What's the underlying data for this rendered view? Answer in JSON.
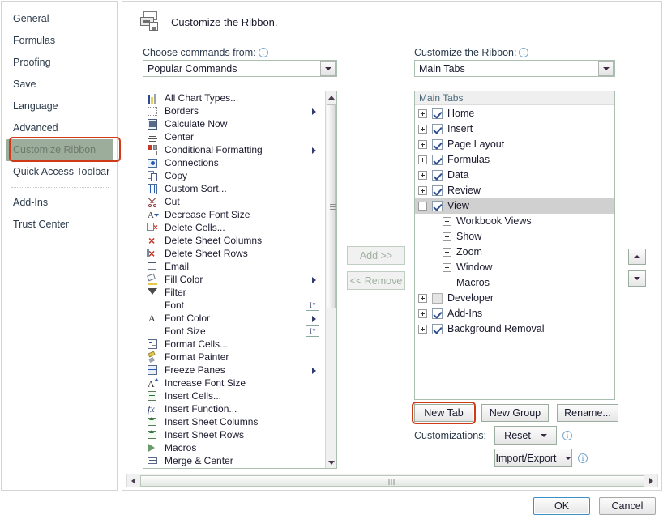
{
  "sidebar": {
    "items": [
      {
        "label": "General",
        "selected": false
      },
      {
        "label": "Formulas",
        "selected": false
      },
      {
        "label": "Proofing",
        "selected": false
      },
      {
        "label": "Save",
        "selected": false
      },
      {
        "label": "Language",
        "selected": false
      },
      {
        "label": "Advanced",
        "selected": false
      },
      {
        "label": "Customize Ribbon",
        "selected": true
      },
      {
        "label": "Quick Access Toolbar",
        "selected": false
      },
      {
        "label": "Add-Ins",
        "selected": false
      },
      {
        "label": "Trust Center",
        "selected": false
      }
    ]
  },
  "header": {
    "title": "Customize the Ribbon.",
    "icon": "customize-ribbon-icon"
  },
  "left_panel": {
    "label_prefix": "C",
    "label_rest": "hoose commands from:",
    "info_icon": "info-icon",
    "dropdown_value": "Popular Commands",
    "commands": [
      {
        "label": "All Chart Types...",
        "icon": "chart-icon",
        "submenu": false,
        "combo": false
      },
      {
        "label": "Borders",
        "icon": "borders-icon",
        "submenu": true,
        "combo": false
      },
      {
        "label": "Calculate Now",
        "icon": "calculator-icon",
        "submenu": false,
        "combo": false
      },
      {
        "label": "Center",
        "icon": "center-align-icon",
        "submenu": false,
        "combo": false
      },
      {
        "label": "Conditional Formatting",
        "icon": "conditional-formatting-icon",
        "submenu": true,
        "combo": false
      },
      {
        "label": "Connections",
        "icon": "connections-icon",
        "submenu": false,
        "combo": false
      },
      {
        "label": "Copy",
        "icon": "copy-icon",
        "submenu": false,
        "combo": false
      },
      {
        "label": "Custom Sort...",
        "icon": "sort-icon",
        "submenu": false,
        "combo": false
      },
      {
        "label": "Cut",
        "icon": "scissors-icon",
        "submenu": false,
        "combo": false
      },
      {
        "label": "Decrease Font Size",
        "icon": "decrease-font-icon",
        "submenu": false,
        "combo": false
      },
      {
        "label": "Delete Cells...",
        "icon": "delete-cells-icon",
        "submenu": false,
        "combo": false
      },
      {
        "label": "Delete Sheet Columns",
        "icon": "delete-columns-icon",
        "submenu": false,
        "combo": false
      },
      {
        "label": "Delete Sheet Rows",
        "icon": "delete-rows-icon",
        "submenu": false,
        "combo": false
      },
      {
        "label": "Email",
        "icon": "email-icon",
        "submenu": false,
        "combo": false
      },
      {
        "label": "Fill Color",
        "icon": "fill-color-icon",
        "submenu": true,
        "combo": false
      },
      {
        "label": "Filter",
        "icon": "filter-icon",
        "submenu": false,
        "combo": false
      },
      {
        "label": "Font",
        "icon": "none",
        "submenu": false,
        "combo": true
      },
      {
        "label": "Font Color",
        "icon": "font-color-icon",
        "submenu": true,
        "combo": false
      },
      {
        "label": "Font Size",
        "icon": "none",
        "submenu": false,
        "combo": true
      },
      {
        "label": "Format Cells...",
        "icon": "format-cells-icon",
        "submenu": false,
        "combo": false
      },
      {
        "label": "Format Painter",
        "icon": "format-painter-icon",
        "submenu": false,
        "combo": false
      },
      {
        "label": "Freeze Panes",
        "icon": "freeze-panes-icon",
        "submenu": true,
        "combo": false
      },
      {
        "label": "Increase Font Size",
        "icon": "increase-font-icon",
        "submenu": false,
        "combo": false
      },
      {
        "label": "Insert Cells...",
        "icon": "insert-cells-icon",
        "submenu": false,
        "combo": false
      },
      {
        "label": "Insert Function...",
        "icon": "insert-function-icon",
        "submenu": false,
        "combo": false
      },
      {
        "label": "Insert Sheet Columns",
        "icon": "insert-columns-icon",
        "submenu": false,
        "combo": false
      },
      {
        "label": "Insert Sheet Rows",
        "icon": "insert-rows-icon",
        "submenu": false,
        "combo": false
      },
      {
        "label": "Macros",
        "icon": "macros-icon",
        "submenu": false,
        "combo": false
      },
      {
        "label": "Merge & Center",
        "icon": "merge-center-icon",
        "submenu": false,
        "combo": false
      }
    ]
  },
  "transfer": {
    "add_prefix": "",
    "add_label": "Add >>",
    "remove_label": "<< Remove",
    "add_enabled": false,
    "remove_enabled": false
  },
  "right_panel": {
    "label_prefix": "Customize the Ri",
    "label_rest": "bbon:",
    "info_icon": "info-icon",
    "dropdown_value": "Main Tabs",
    "tree_header": "Main Tabs",
    "tree": [
      {
        "label": "Home",
        "level": 0,
        "checkbox": "checked",
        "expander": "plus",
        "selected": false
      },
      {
        "label": "Insert",
        "level": 0,
        "checkbox": "checked",
        "expander": "plus",
        "selected": false
      },
      {
        "label": "Page Layout",
        "level": 0,
        "checkbox": "checked",
        "expander": "plus",
        "selected": false
      },
      {
        "label": "Formulas",
        "level": 0,
        "checkbox": "checked",
        "expander": "plus",
        "selected": false
      },
      {
        "label": "Data",
        "level": 0,
        "checkbox": "checked",
        "expander": "plus",
        "selected": false
      },
      {
        "label": "Review",
        "level": 0,
        "checkbox": "checked",
        "expander": "plus",
        "selected": false
      },
      {
        "label": "View",
        "level": 0,
        "checkbox": "checked",
        "expander": "minus",
        "selected": true
      },
      {
        "label": "Workbook Views",
        "level": 1,
        "checkbox": "none",
        "expander": "plus",
        "selected": false
      },
      {
        "label": "Show",
        "level": 1,
        "checkbox": "none",
        "expander": "plus",
        "selected": false
      },
      {
        "label": "Zoom",
        "level": 1,
        "checkbox": "none",
        "expander": "plus",
        "selected": false
      },
      {
        "label": "Window",
        "level": 1,
        "checkbox": "none",
        "expander": "plus",
        "selected": false
      },
      {
        "label": "Macros",
        "level": 1,
        "checkbox": "none",
        "expander": "plus",
        "selected": false
      },
      {
        "label": "Developer",
        "level": 0,
        "checkbox": "off",
        "expander": "plus",
        "selected": false
      },
      {
        "label": "Add-Ins",
        "level": 0,
        "checkbox": "checked",
        "expander": "plus",
        "selected": false
      },
      {
        "label": "Background Removal",
        "level": 0,
        "checkbox": "checked",
        "expander": "plus",
        "selected": false
      }
    ],
    "move_up_icon": "arrow-up-icon",
    "move_down_icon": "arrow-down-icon"
  },
  "tab_buttons": {
    "new_tab": "New Tab",
    "new_group": "New Group",
    "rename": "Rename...",
    "highlighted": "New Tab"
  },
  "customizations": {
    "label": "Customizations:",
    "reset": "Reset",
    "import_export": "Import/Export"
  },
  "footer": {
    "ok": "OK",
    "cancel": "Cancel"
  },
  "colors": {
    "selected_nav_bg": "#9cae9b",
    "annotation": "#cf3a17",
    "tree_selected_bg": "#d0d0d0",
    "focus_border": "#3c8ec4"
  }
}
